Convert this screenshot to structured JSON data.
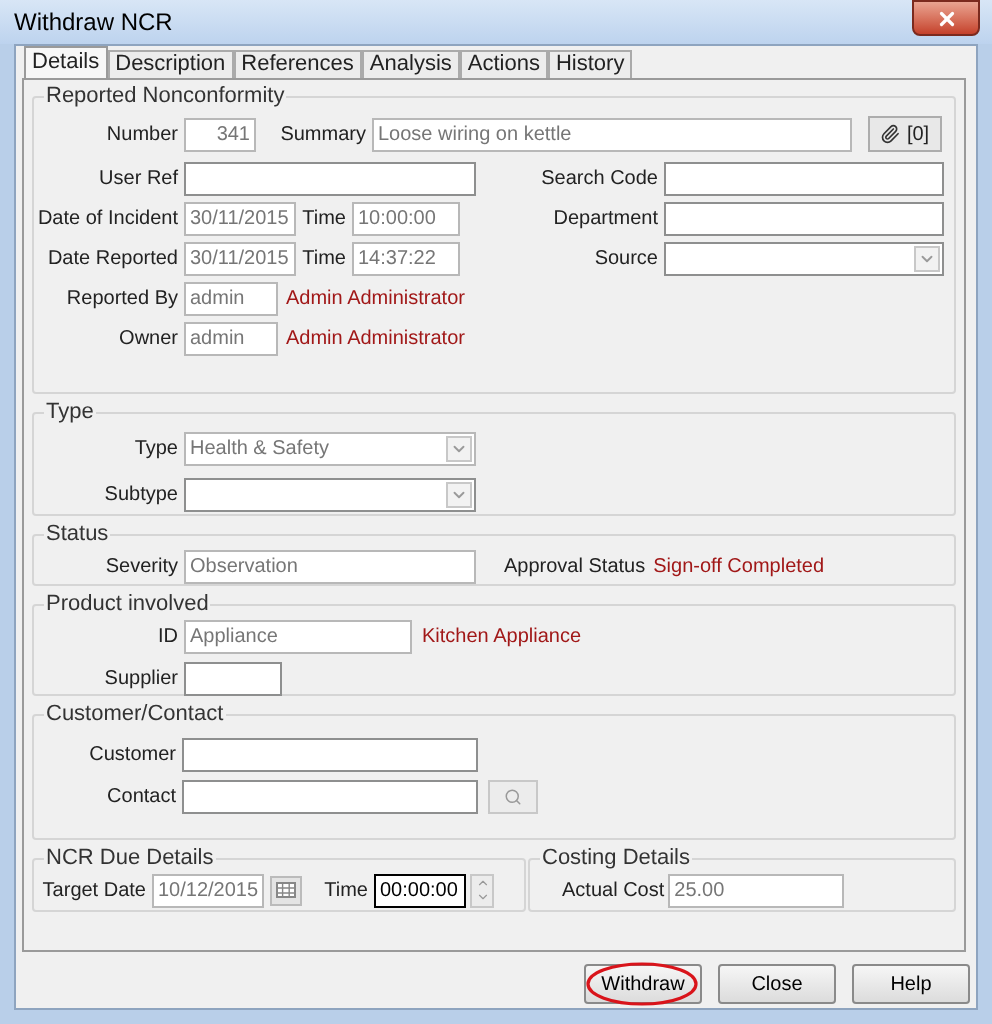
{
  "window": {
    "title": "Withdraw NCR"
  },
  "tabs": [
    {
      "label": "Details",
      "selected": true
    },
    {
      "label": "Description",
      "selected": false
    },
    {
      "label": "References",
      "selected": false
    },
    {
      "label": "Analysis",
      "selected": false
    },
    {
      "label": "Actions",
      "selected": false
    },
    {
      "label": "History",
      "selected": false
    }
  ],
  "reported": {
    "title": "Reported Nonconformity",
    "number": {
      "label": "Number",
      "value": "341",
      "disabled": true
    },
    "summary": {
      "label": "Summary",
      "value": "Loose wiring on kettle",
      "disabled": true
    },
    "attachments": "[0]",
    "user_ref": {
      "label": "User Ref",
      "disabled": false
    },
    "search_code": {
      "label": "Search Code",
      "disabled": false
    },
    "date_of_incident": {
      "label": "Date of Incident",
      "value": "30/11/2015",
      "disabled": true
    },
    "incident_time": {
      "label": "Time",
      "value": "10:00:00",
      "disabled": true
    },
    "department": {
      "label": "Department",
      "disabled": false
    },
    "date_reported": {
      "label": "Date Reported",
      "value": "30/11/2015",
      "disabled": true
    },
    "reported_time": {
      "label": "Time",
      "value": "14:37:22",
      "disabled": true
    },
    "source": {
      "label": "Source",
      "disabled": false
    },
    "reported_by": {
      "label": "Reported By",
      "value": "admin",
      "disabled": true,
      "name": "Admin Administrator"
    },
    "owner": {
      "label": "Owner",
      "value": "admin",
      "disabled": true,
      "name": "Admin Administrator"
    }
  },
  "type": {
    "title": "Type",
    "type": {
      "label": "Type",
      "value": "Health & Safety",
      "disabled": true
    },
    "subtype": {
      "label": "Subtype",
      "disabled": false
    }
  },
  "status": {
    "title": "Status",
    "severity": {
      "label": "Severity",
      "value": "Observation",
      "disabled": true
    },
    "approval_label": "Approval Status",
    "approval_status": "Sign-off Completed"
  },
  "product": {
    "title": "Product involved",
    "id": {
      "label": "ID",
      "value": "Appliance",
      "disabled": true,
      "name": "Kitchen Appliance"
    },
    "supplier": {
      "label": "Supplier",
      "disabled": false
    }
  },
  "customer": {
    "title": "Customer/Contact",
    "customer": {
      "label": "Customer",
      "disabled": false
    },
    "contact": {
      "label": "Contact",
      "disabled": false
    }
  },
  "due": {
    "title": "NCR Due Details",
    "target_date": {
      "label": "Target Date",
      "value": "10/12/2015",
      "disabled": true
    },
    "time": {
      "label": "Time",
      "value": "00:00:00",
      "disabled": false
    }
  },
  "costing": {
    "title": "Costing Details",
    "actual_cost": {
      "label": "Actual Cost",
      "value": "25.00",
      "disabled": true
    }
  },
  "buttons": [
    {
      "label": "Withdraw",
      "highlighted": true
    },
    {
      "label": "Close",
      "highlighted": false
    },
    {
      "label": "Help",
      "highlighted": false
    }
  ]
}
